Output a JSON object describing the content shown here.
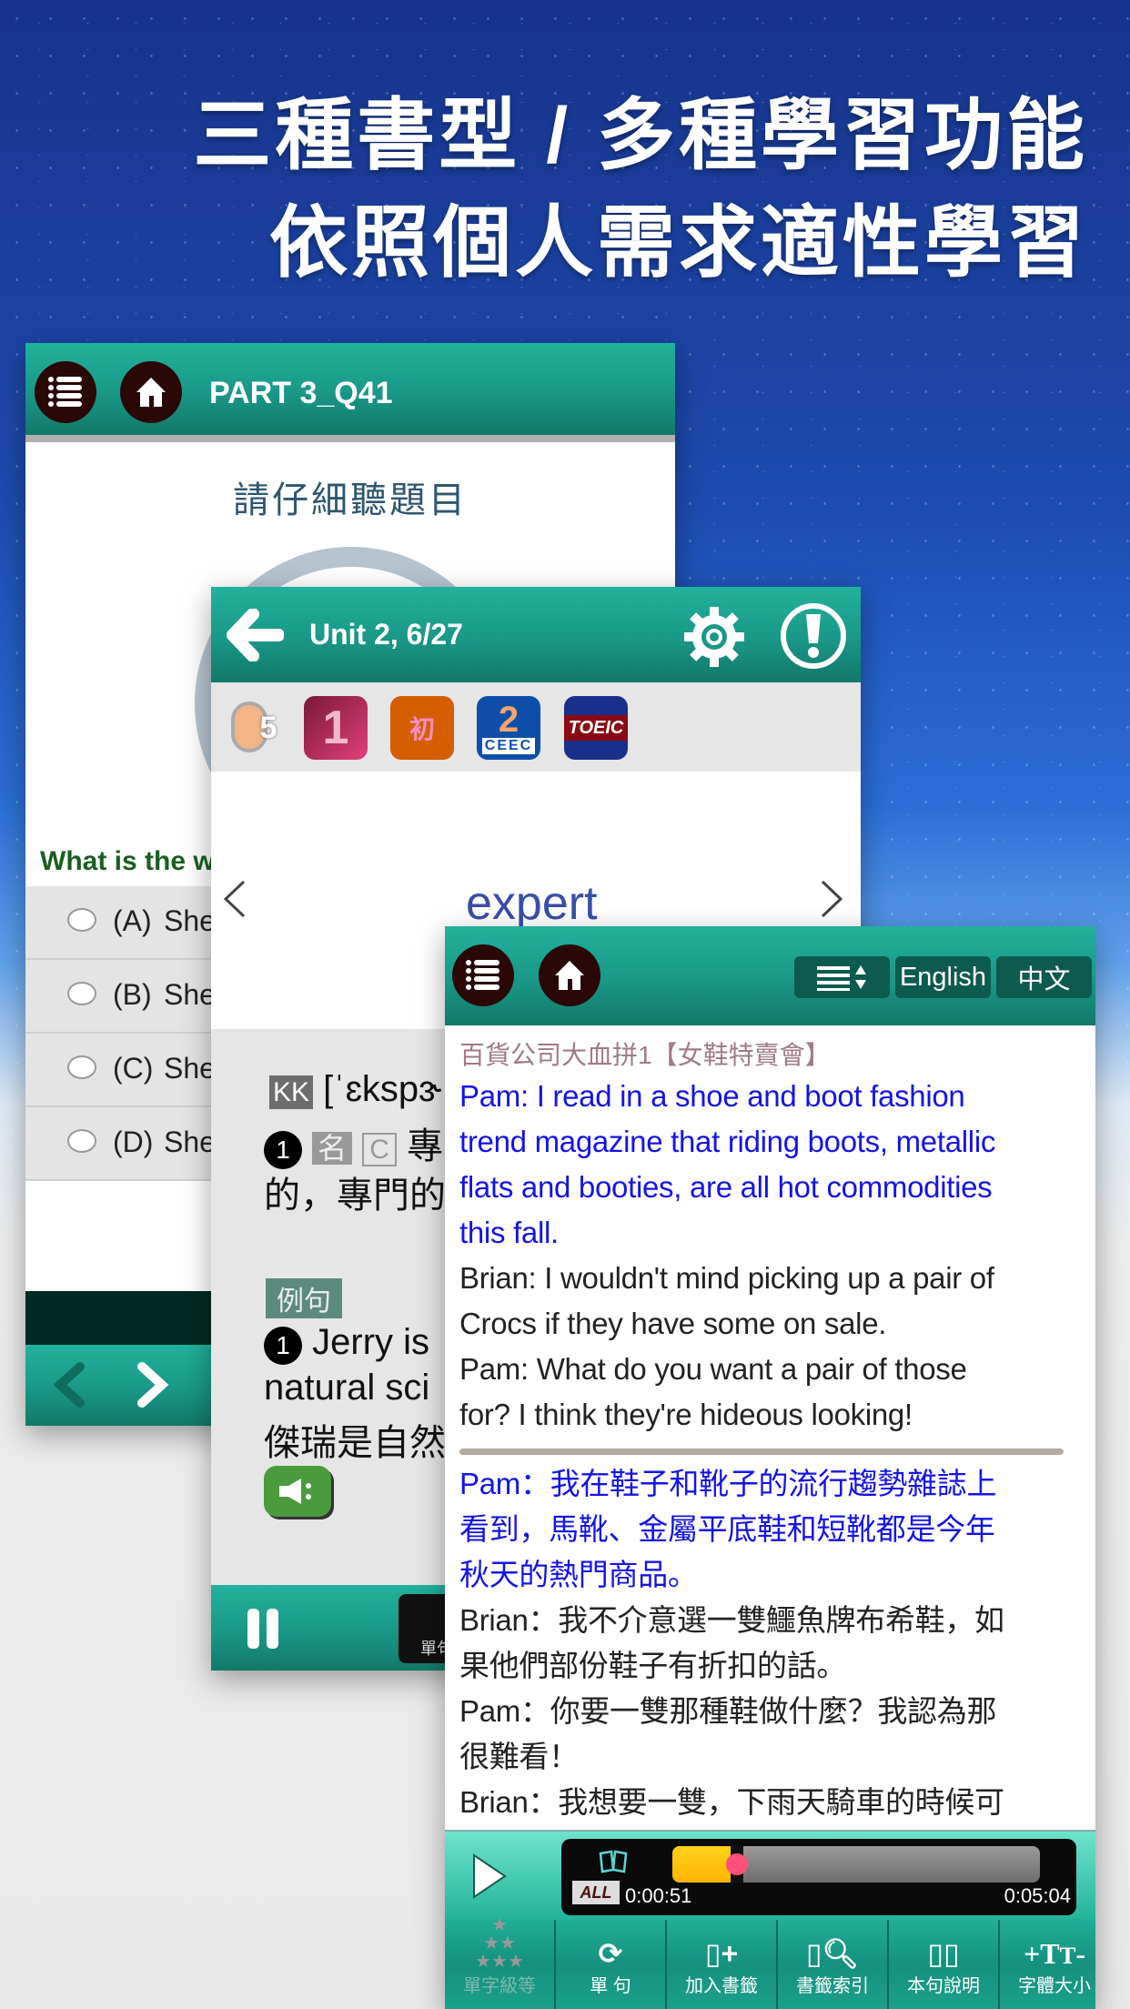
{
  "headline": {
    "line1": "三種書型 / 多種學習功能",
    "line2": "依照個人需求適性學習"
  },
  "colors": {
    "teal": "#1a9787",
    "header_btn": "#2a0808",
    "dialog_blue": "#1414e6",
    "question_green": "#1b5e20",
    "progress_fill": "#ffc400",
    "progress_knob": "#ff4f7b"
  },
  "quiz_panel": {
    "title": "PART 3_Q41",
    "prompt": "請仔細聽題目",
    "question": "What is the w",
    "options": [
      {
        "letter": "(A)",
        "text": "She"
      },
      {
        "letter": "(B)",
        "text": "She"
      },
      {
        "letter": "(C)",
        "text": "She"
      },
      {
        "letter": "(D)",
        "text": "She"
      }
    ],
    "icons": [
      "list-icon",
      "home-icon",
      "chevron-left-icon",
      "chevron-right-icon"
    ]
  },
  "vocab_panel": {
    "title": "Unit 2, 6/27",
    "badges": [
      "5",
      "1",
      "初",
      "2",
      "TOEIC"
    ],
    "badge_sub": "CEEC",
    "word": "expert",
    "kk_label": "KK",
    "phonetic": "[ˈɛkspɝ",
    "sense_num": "1",
    "pos": "名",
    "countable": "C",
    "definition_1": "專",
    "definition_2": "的，專門的",
    "example_label": "例句",
    "example_en_1": "Jerry is",
    "example_en_2": "natural sci",
    "example_zh": "傑瑞是自然",
    "bottom_btn": "單句"
  },
  "reader_panel": {
    "lang_en": "English",
    "lang_zh": "中文",
    "lesson_title": "百貨公司大血拼1【女鞋特賣會】",
    "english_lines": [
      {
        "text": "Pam: I read in a shoe and boot fashion",
        "hl": true
      },
      {
        "text": "trend magazine that riding boots, metallic",
        "hl": true
      },
      {
        "text": "flats and booties, are all hot commodities",
        "hl": true
      },
      {
        "text": "this fall.",
        "hl": true
      },
      {
        "text": "Brian: I wouldn't mind picking up a pair of",
        "hl": false
      },
      {
        "text": "Crocs if they have some on sale.",
        "hl": false
      },
      {
        "text": "Pam: What do you want a pair of those",
        "hl": false
      },
      {
        "text": "for? I think they're hideous looking!",
        "hl": false
      }
    ],
    "chinese_lines": [
      {
        "text": "Pam：我在鞋子和靴子的流行趨勢雜誌上",
        "hl": true
      },
      {
        "text": "看到，馬靴、金屬平底鞋和短靴都是今年",
        "hl": true
      },
      {
        "text": "秋天的熱門商品。",
        "hl": true
      },
      {
        "text": "Brian：我不介意選一雙鱷魚牌布希鞋，如",
        "hl": false
      },
      {
        "text": "果他們部份鞋子有折扣的話。",
        "hl": false
      },
      {
        "text": "Pam：你要一雙那種鞋做什麼？我認為那",
        "hl": false
      },
      {
        "text": "很難看！",
        "hl": false
      },
      {
        "text": "Brian：我想要一雙，下雨天騎車的時候可",
        "hl": false
      }
    ],
    "player": {
      "mode": "ALL",
      "current": "0:00:51",
      "total": "0:05:04",
      "progress": 0.168
    },
    "toolbar": [
      {
        "label": "單字級等",
        "icon": "stars-icon",
        "disabled": true
      },
      {
        "label": "單 句",
        "icon": "repeat-icon",
        "disabled": false
      },
      {
        "label": "加入書籤",
        "icon": "add-bookmark-icon",
        "disabled": false
      },
      {
        "label": "書籤索引",
        "icon": "bookmark-search-icon",
        "disabled": false
      },
      {
        "label": "本句說明",
        "icon": "book-icon",
        "disabled": false
      },
      {
        "label": "字體大小",
        "icon": "font-size-icon",
        "disabled": false
      }
    ]
  }
}
